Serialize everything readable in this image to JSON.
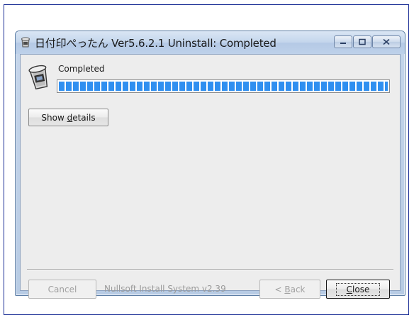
{
  "window": {
    "title": "日付印ぺったん Ver5.6.2.1 Uninstall: Completed",
    "title_icon": "installer-icon",
    "controls": {
      "minimize_icon": "minimize-icon",
      "maximize_icon": "maximize-icon",
      "close_icon": "close-icon"
    }
  },
  "header": {
    "icon": "recycle-bin-icon",
    "status_text": "Completed",
    "progress_percent": 100
  },
  "buttons": {
    "show_details_pre": "Show ",
    "show_details_mnemonic": "d",
    "show_details_post": "etails",
    "cancel": "Cancel",
    "back_pre": "< ",
    "back_mnemonic": "B",
    "back_post": "ack",
    "close_mnemonic": "C",
    "close_post": "lose"
  },
  "footer": {
    "branding": "Nullsoft Install System v2.39"
  },
  "colors": {
    "progress": "#2f8ff0",
    "frame": "#1c2f96",
    "client_bg": "#ededed"
  }
}
